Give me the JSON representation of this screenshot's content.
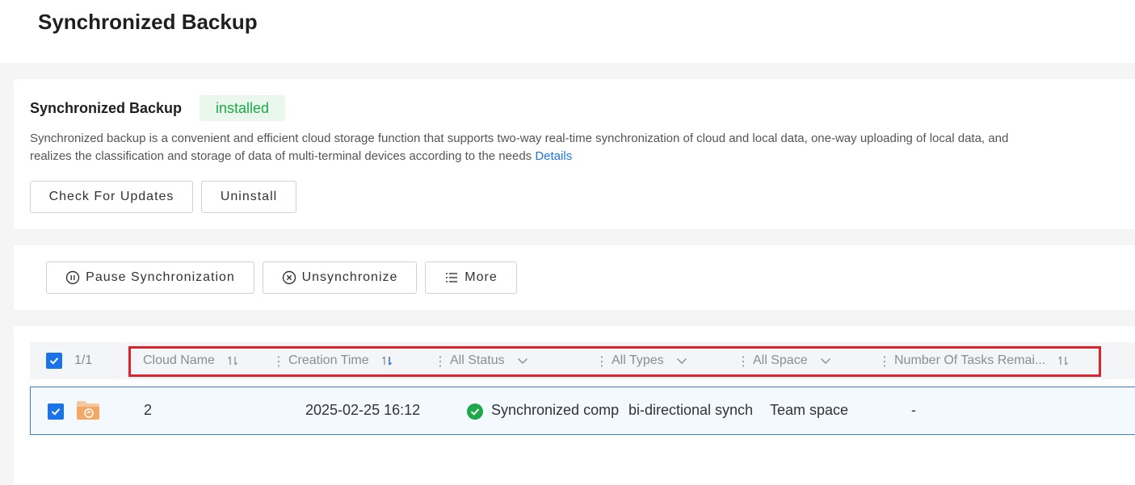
{
  "page": {
    "title": "Synchronized Backup"
  },
  "app": {
    "name": "Synchronized Backup",
    "status": "installed",
    "description": "Synchronized backup is a convenient and efficient cloud storage function that supports two-way real-time synchronization of cloud and local data, one-way uploading of local data, and realizes the classification and storage of data of multi-terminal devices according to the needs",
    "details_link": "Details",
    "buttons": {
      "check_updates": "Check For Updates",
      "uninstall": "Uninstall"
    }
  },
  "toolbar": {
    "pause": "Pause Synchronization",
    "unsync": "Unsynchronize",
    "more": "More"
  },
  "table": {
    "selection_count": "1/1",
    "headers": {
      "cloud_name": "Cloud Name",
      "creation_time": "Creation Time",
      "status": "All Status",
      "types": "All Types",
      "space": "All Space",
      "tasks": "Number Of Tasks Remai..."
    },
    "rows": [
      {
        "cloud_name": "2",
        "creation_time": "2025-02-25 16:12",
        "status": "Synchronized comp",
        "type": "bi-directional synch",
        "space": "Team space",
        "tasks": "-"
      }
    ]
  },
  "colors": {
    "accent": "#1a73e8",
    "success": "#1ea84a",
    "highlight": "#e0212e"
  }
}
